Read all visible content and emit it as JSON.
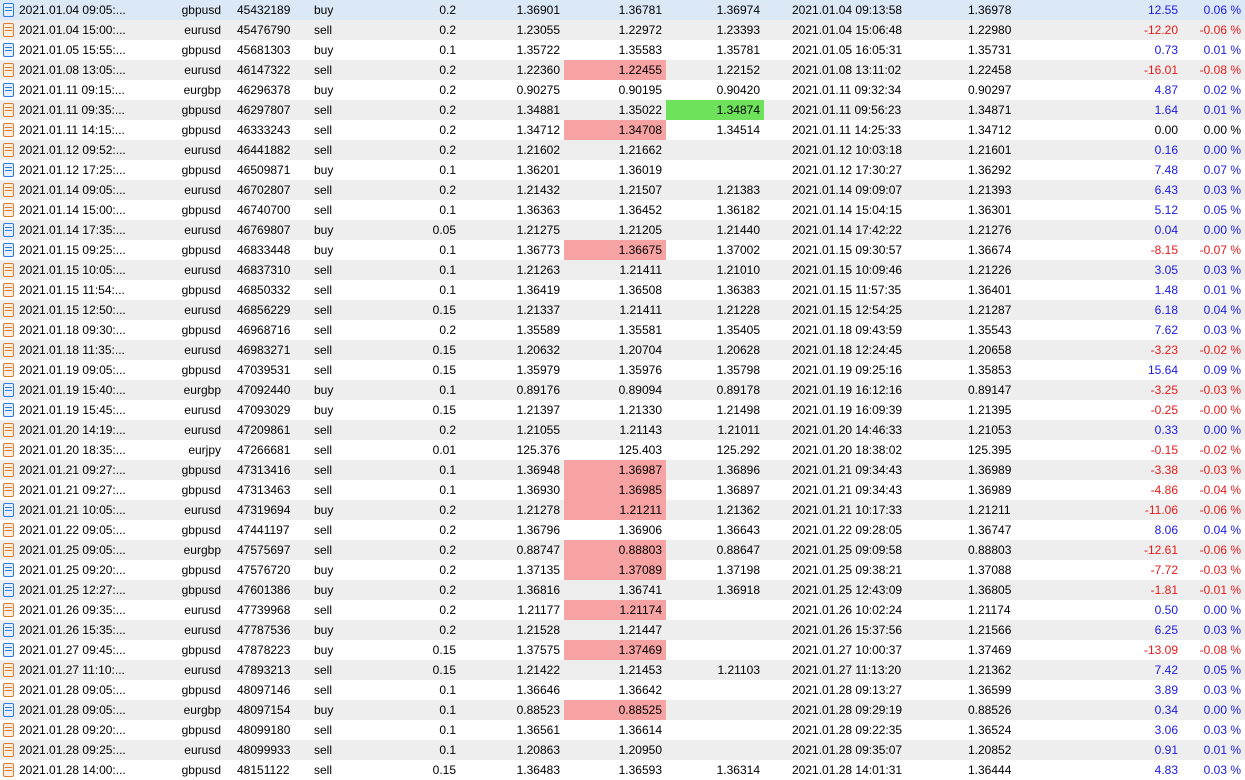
{
  "colors": {
    "profit": "#1a1ae6",
    "loss": "#e61a1a",
    "highlight_red": "#f7a3a3",
    "highlight_green": "#6ee25a",
    "selected_row": "#dbe8f6"
  },
  "trades": [
    {
      "open_time": "2021.01.04 09:05:...",
      "symbol": "gbpusd",
      "ticket": "45432189",
      "type": "buy",
      "volume": "0.2",
      "price": "1.36901",
      "sl": "1.36781",
      "tp": "1.36974",
      "close_time": "2021.01.04 09:13:58",
      "close_price": "1.36978",
      "profit": "12.55",
      "change": "0.06 %",
      "sign": "pos",
      "hl": "",
      "selected": true
    },
    {
      "open_time": "2021.01.04 15:00:...",
      "symbol": "eurusd",
      "ticket": "45476790",
      "type": "sell",
      "volume": "0.2",
      "price": "1.23055",
      "sl": "1.22972",
      "tp": "1.23393",
      "close_time": "2021.01.04 15:06:48",
      "close_price": "1.22980",
      "profit": "-12.20",
      "change": "-0.06 %",
      "sign": "neg",
      "hl": ""
    },
    {
      "open_time": "2021.01.05 15:55:...",
      "symbol": "gbpusd",
      "ticket": "45681303",
      "type": "buy",
      "volume": "0.1",
      "price": "1.35722",
      "sl": "1.35583",
      "tp": "1.35781",
      "close_time": "2021.01.05 16:05:31",
      "close_price": "1.35731",
      "profit": "0.73",
      "change": "0.01 %",
      "sign": "pos",
      "hl": ""
    },
    {
      "open_time": "2021.01.08 13:05:...",
      "symbol": "eurusd",
      "ticket": "46147322",
      "type": "sell",
      "volume": "0.2",
      "price": "1.22360",
      "sl": "1.22455",
      "tp": "1.22152",
      "close_time": "2021.01.08 13:11:02",
      "close_price": "1.22458",
      "profit": "-16.01",
      "change": "-0.08 %",
      "sign": "neg",
      "hl": "sl"
    },
    {
      "open_time": "2021.01.11 09:15:...",
      "symbol": "eurgbp",
      "ticket": "46296378",
      "type": "buy",
      "volume": "0.2",
      "price": "0.90275",
      "sl": "0.90195",
      "tp": "0.90420",
      "close_time": "2021.01.11 09:32:34",
      "close_price": "0.90297",
      "profit": "4.87",
      "change": "0.02 %",
      "sign": "pos",
      "hl": ""
    },
    {
      "open_time": "2021.01.11 09:35:...",
      "symbol": "gbpusd",
      "ticket": "46297807",
      "type": "sell",
      "volume": "0.2",
      "price": "1.34881",
      "sl": "1.35022",
      "tp": "1.34874",
      "close_time": "2021.01.11 09:56:23",
      "close_price": "1.34871",
      "profit": "1.64",
      "change": "0.01 %",
      "sign": "pos",
      "hl": "tp"
    },
    {
      "open_time": "2021.01.11 14:15:...",
      "symbol": "gbpusd",
      "ticket": "46333243",
      "type": "sell",
      "volume": "0.2",
      "price": "1.34712",
      "sl": "1.34708",
      "tp": "1.34514",
      "close_time": "2021.01.11 14:25:33",
      "close_price": "1.34712",
      "profit": "0.00",
      "change": "0.00 %",
      "sign": "zero",
      "hl": "sl"
    },
    {
      "open_time": "2021.01.12 09:52:...",
      "symbol": "eurusd",
      "ticket": "46441882",
      "type": "sell",
      "volume": "0.2",
      "price": "1.21602",
      "sl": "1.21662",
      "tp": "",
      "close_time": "2021.01.12 10:03:18",
      "close_price": "1.21601",
      "profit": "0.16",
      "change": "0.00 %",
      "sign": "pos",
      "hl": ""
    },
    {
      "open_time": "2021.01.12 17:25:...",
      "symbol": "gbpusd",
      "ticket": "46509871",
      "type": "buy",
      "volume": "0.1",
      "price": "1.36201",
      "sl": "1.36019",
      "tp": "",
      "close_time": "2021.01.12 17:30:27",
      "close_price": "1.36292",
      "profit": "7.48",
      "change": "0.07 %",
      "sign": "pos",
      "hl": ""
    },
    {
      "open_time": "2021.01.14 09:05:...",
      "symbol": "eurusd",
      "ticket": "46702807",
      "type": "sell",
      "volume": "0.2",
      "price": "1.21432",
      "sl": "1.21507",
      "tp": "1.21383",
      "close_time": "2021.01.14 09:09:07",
      "close_price": "1.21393",
      "profit": "6.43",
      "change": "0.03 %",
      "sign": "pos",
      "hl": ""
    },
    {
      "open_time": "2021.01.14 15:00:...",
      "symbol": "gbpusd",
      "ticket": "46740700",
      "type": "sell",
      "volume": "0.1",
      "price": "1.36363",
      "sl": "1.36452",
      "tp": "1.36182",
      "close_time": "2021.01.14 15:04:15",
      "close_price": "1.36301",
      "profit": "5.12",
      "change": "0.05 %",
      "sign": "pos",
      "hl": ""
    },
    {
      "open_time": "2021.01.14 17:35:...",
      "symbol": "eurusd",
      "ticket": "46769807",
      "type": "buy",
      "volume": "0.05",
      "price": "1.21275",
      "sl": "1.21205",
      "tp": "1.21440",
      "close_time": "2021.01.14 17:42:22",
      "close_price": "1.21276",
      "profit": "0.04",
      "change": "0.00 %",
      "sign": "pos",
      "hl": ""
    },
    {
      "open_time": "2021.01.15 09:25:...",
      "symbol": "gbpusd",
      "ticket": "46833448",
      "type": "buy",
      "volume": "0.1",
      "price": "1.36773",
      "sl": "1.36675",
      "tp": "1.37002",
      "close_time": "2021.01.15 09:30:57",
      "close_price": "1.36674",
      "profit": "-8.15",
      "change": "-0.07 %",
      "sign": "neg",
      "hl": "sl"
    },
    {
      "open_time": "2021.01.15 10:05:...",
      "symbol": "eurusd",
      "ticket": "46837310",
      "type": "sell",
      "volume": "0.1",
      "price": "1.21263",
      "sl": "1.21411",
      "tp": "1.21010",
      "close_time": "2021.01.15 10:09:46",
      "close_price": "1.21226",
      "profit": "3.05",
      "change": "0.03 %",
      "sign": "pos",
      "hl": ""
    },
    {
      "open_time": "2021.01.15 11:54:...",
      "symbol": "gbpusd",
      "ticket": "46850332",
      "type": "sell",
      "volume": "0.1",
      "price": "1.36419",
      "sl": "1.36508",
      "tp": "1.36383",
      "close_time": "2021.01.15 11:57:35",
      "close_price": "1.36401",
      "profit": "1.48",
      "change": "0.01 %",
      "sign": "pos",
      "hl": ""
    },
    {
      "open_time": "2021.01.15 12:50:...",
      "symbol": "eurusd",
      "ticket": "46856229",
      "type": "sell",
      "volume": "0.15",
      "price": "1.21337",
      "sl": "1.21411",
      "tp": "1.21228",
      "close_time": "2021.01.15 12:54:25",
      "close_price": "1.21287",
      "profit": "6.18",
      "change": "0.04 %",
      "sign": "pos",
      "hl": ""
    },
    {
      "open_time": "2021.01.18 09:30:...",
      "symbol": "gbpusd",
      "ticket": "46968716",
      "type": "sell",
      "volume": "0.2",
      "price": "1.35589",
      "sl": "1.35581",
      "tp": "1.35405",
      "close_time": "2021.01.18 09:43:59",
      "close_price": "1.35543",
      "profit": "7.62",
      "change": "0.03 %",
      "sign": "pos",
      "hl": ""
    },
    {
      "open_time": "2021.01.18 11:35:...",
      "symbol": "eurusd",
      "ticket": "46983271",
      "type": "sell",
      "volume": "0.15",
      "price": "1.20632",
      "sl": "1.20704",
      "tp": "1.20628",
      "close_time": "2021.01.18 12:24:45",
      "close_price": "1.20658",
      "profit": "-3.23",
      "change": "-0.02 %",
      "sign": "neg",
      "hl": ""
    },
    {
      "open_time": "2021.01.19 09:05:...",
      "symbol": "gbpusd",
      "ticket": "47039531",
      "type": "sell",
      "volume": "0.15",
      "price": "1.35979",
      "sl": "1.35976",
      "tp": "1.35798",
      "close_time": "2021.01.19 09:25:16",
      "close_price": "1.35853",
      "profit": "15.64",
      "change": "0.09 %",
      "sign": "pos",
      "hl": ""
    },
    {
      "open_time": "2021.01.19 15:40:...",
      "symbol": "eurgbp",
      "ticket": "47092440",
      "type": "buy",
      "volume": "0.1",
      "price": "0.89176",
      "sl": "0.89094",
      "tp": "0.89178",
      "close_time": "2021.01.19 16:12:16",
      "close_price": "0.89147",
      "profit": "-3.25",
      "change": "-0.03 %",
      "sign": "neg",
      "hl": ""
    },
    {
      "open_time": "2021.01.19 15:45:...",
      "symbol": "eurusd",
      "ticket": "47093029",
      "type": "buy",
      "volume": "0.15",
      "price": "1.21397",
      "sl": "1.21330",
      "tp": "1.21498",
      "close_time": "2021.01.19 16:09:39",
      "close_price": "1.21395",
      "profit": "-0.25",
      "change": "-0.00 %",
      "sign": "neg",
      "hl": ""
    },
    {
      "open_time": "2021.01.20 14:19:...",
      "symbol": "eurusd",
      "ticket": "47209861",
      "type": "sell",
      "volume": "0.2",
      "price": "1.21055",
      "sl": "1.21143",
      "tp": "1.21011",
      "close_time": "2021.01.20 14:46:33",
      "close_price": "1.21053",
      "profit": "0.33",
      "change": "0.00 %",
      "sign": "pos",
      "hl": ""
    },
    {
      "open_time": "2021.01.20 18:35:...",
      "symbol": "eurjpy",
      "ticket": "47266681",
      "type": "sell",
      "volume": "0.01",
      "price": "125.376",
      "sl": "125.403",
      "tp": "125.292",
      "close_time": "2021.01.20 18:38:02",
      "close_price": "125.395",
      "profit": "-0.15",
      "change": "-0.02 %",
      "sign": "neg",
      "hl": ""
    },
    {
      "open_time": "2021.01.21 09:27:...",
      "symbol": "gbpusd",
      "ticket": "47313416",
      "type": "sell",
      "volume": "0.1",
      "price": "1.36948",
      "sl": "1.36987",
      "tp": "1.36896",
      "close_time": "2021.01.21 09:34:43",
      "close_price": "1.36989",
      "profit": "-3.38",
      "change": "-0.03 %",
      "sign": "neg",
      "hl": "sl"
    },
    {
      "open_time": "2021.01.21 09:27:...",
      "symbol": "gbpusd",
      "ticket": "47313463",
      "type": "sell",
      "volume": "0.1",
      "price": "1.36930",
      "sl": "1.36985",
      "tp": "1.36897",
      "close_time": "2021.01.21 09:34:43",
      "close_price": "1.36989",
      "profit": "-4.86",
      "change": "-0.04 %",
      "sign": "neg",
      "hl": "sl"
    },
    {
      "open_time": "2021.01.21 10:05:...",
      "symbol": "eurusd",
      "ticket": "47319694",
      "type": "buy",
      "volume": "0.2",
      "price": "1.21278",
      "sl": "1.21211",
      "tp": "1.21362",
      "close_time": "2021.01.21 10:17:33",
      "close_price": "1.21211",
      "profit": "-11.06",
      "change": "-0.06 %",
      "sign": "neg",
      "hl": "sl"
    },
    {
      "open_time": "2021.01.22 09:05:...",
      "symbol": "gbpusd",
      "ticket": "47441197",
      "type": "sell",
      "volume": "0.2",
      "price": "1.36796",
      "sl": "1.36906",
      "tp": "1.36643",
      "close_time": "2021.01.22 09:28:05",
      "close_price": "1.36747",
      "profit": "8.06",
      "change": "0.04 %",
      "sign": "pos",
      "hl": ""
    },
    {
      "open_time": "2021.01.25 09:05:...",
      "symbol": "eurgbp",
      "ticket": "47575697",
      "type": "sell",
      "volume": "0.2",
      "price": "0.88747",
      "sl": "0.88803",
      "tp": "0.88647",
      "close_time": "2021.01.25 09:09:58",
      "close_price": "0.88803",
      "profit": "-12.61",
      "change": "-0.06 %",
      "sign": "neg",
      "hl": "sl"
    },
    {
      "open_time": "2021.01.25 09:20:...",
      "symbol": "gbpusd",
      "ticket": "47576720",
      "type": "buy",
      "volume": "0.2",
      "price": "1.37135",
      "sl": "1.37089",
      "tp": "1.37198",
      "close_time": "2021.01.25 09:38:21",
      "close_price": "1.37088",
      "profit": "-7.72",
      "change": "-0.03 %",
      "sign": "neg",
      "hl": "sl"
    },
    {
      "open_time": "2021.01.25 12:27:...",
      "symbol": "gbpusd",
      "ticket": "47601386",
      "type": "buy",
      "volume": "0.2",
      "price": "1.36816",
      "sl": "1.36741",
      "tp": "1.36918",
      "close_time": "2021.01.25 12:43:09",
      "close_price": "1.36805",
      "profit": "-1.81",
      "change": "-0.01 %",
      "sign": "neg",
      "hl": ""
    },
    {
      "open_time": "2021.01.26 09:35:...",
      "symbol": "eurusd",
      "ticket": "47739968",
      "type": "sell",
      "volume": "0.2",
      "price": "1.21177",
      "sl": "1.21174",
      "tp": "",
      "close_time": "2021.01.26 10:02:24",
      "close_price": "1.21174",
      "profit": "0.50",
      "change": "0.00 %",
      "sign": "pos",
      "hl": "sl"
    },
    {
      "open_time": "2021.01.26 15:35:...",
      "symbol": "eurusd",
      "ticket": "47787536",
      "type": "buy",
      "volume": "0.2",
      "price": "1.21528",
      "sl": "1.21447",
      "tp": "",
      "close_time": "2021.01.26 15:37:56",
      "close_price": "1.21566",
      "profit": "6.25",
      "change": "0.03 %",
      "sign": "pos",
      "hl": ""
    },
    {
      "open_time": "2021.01.27 09:45:...",
      "symbol": "gbpusd",
      "ticket": "47878223",
      "type": "buy",
      "volume": "0.15",
      "price": "1.37575",
      "sl": "1.37469",
      "tp": "",
      "close_time": "2021.01.27 10:00:37",
      "close_price": "1.37469",
      "profit": "-13.09",
      "change": "-0.08 %",
      "sign": "neg",
      "hl": "sl"
    },
    {
      "open_time": "2021.01.27 11:10:...",
      "symbol": "eurusd",
      "ticket": "47893213",
      "type": "sell",
      "volume": "0.15",
      "price": "1.21422",
      "sl": "1.21453",
      "tp": "1.21103",
      "close_time": "2021.01.27 11:13:20",
      "close_price": "1.21362",
      "profit": "7.42",
      "change": "0.05 %",
      "sign": "pos",
      "hl": ""
    },
    {
      "open_time": "2021.01.28 09:05:...",
      "symbol": "gbpusd",
      "ticket": "48097146",
      "type": "sell",
      "volume": "0.1",
      "price": "1.36646",
      "sl": "1.36642",
      "tp": "",
      "close_time": "2021.01.28 09:13:27",
      "close_price": "1.36599",
      "profit": "3.89",
      "change": "0.03 %",
      "sign": "pos",
      "hl": ""
    },
    {
      "open_time": "2021.01.28 09:05:...",
      "symbol": "eurgbp",
      "ticket": "48097154",
      "type": "buy",
      "volume": "0.1",
      "price": "0.88523",
      "sl": "0.88525",
      "tp": "",
      "close_time": "2021.01.28 09:29:19",
      "close_price": "0.88526",
      "profit": "0.34",
      "change": "0.00 %",
      "sign": "pos",
      "hl": "sl"
    },
    {
      "open_time": "2021.01.28 09:20:...",
      "symbol": "gbpusd",
      "ticket": "48099180",
      "type": "sell",
      "volume": "0.1",
      "price": "1.36561",
      "sl": "1.36614",
      "tp": "",
      "close_time": "2021.01.28 09:22:35",
      "close_price": "1.36524",
      "profit": "3.06",
      "change": "0.03 %",
      "sign": "pos",
      "hl": ""
    },
    {
      "open_time": "2021.01.28 09:25:...",
      "symbol": "eurusd",
      "ticket": "48099933",
      "type": "sell",
      "volume": "0.1",
      "price": "1.20863",
      "sl": "1.20950",
      "tp": "",
      "close_time": "2021.01.28 09:35:07",
      "close_price": "1.20852",
      "profit": "0.91",
      "change": "0.01 %",
      "sign": "pos",
      "hl": ""
    },
    {
      "open_time": "2021.01.28 14:00:...",
      "symbol": "gbpusd",
      "ticket": "48151122",
      "type": "sell",
      "volume": "0.15",
      "price": "1.36483",
      "sl": "1.36593",
      "tp": "1.36314",
      "close_time": "2021.01.28 14:01:31",
      "close_price": "1.36444",
      "profit": "4.83",
      "change": "0.03 %",
      "sign": "pos",
      "hl": ""
    }
  ]
}
